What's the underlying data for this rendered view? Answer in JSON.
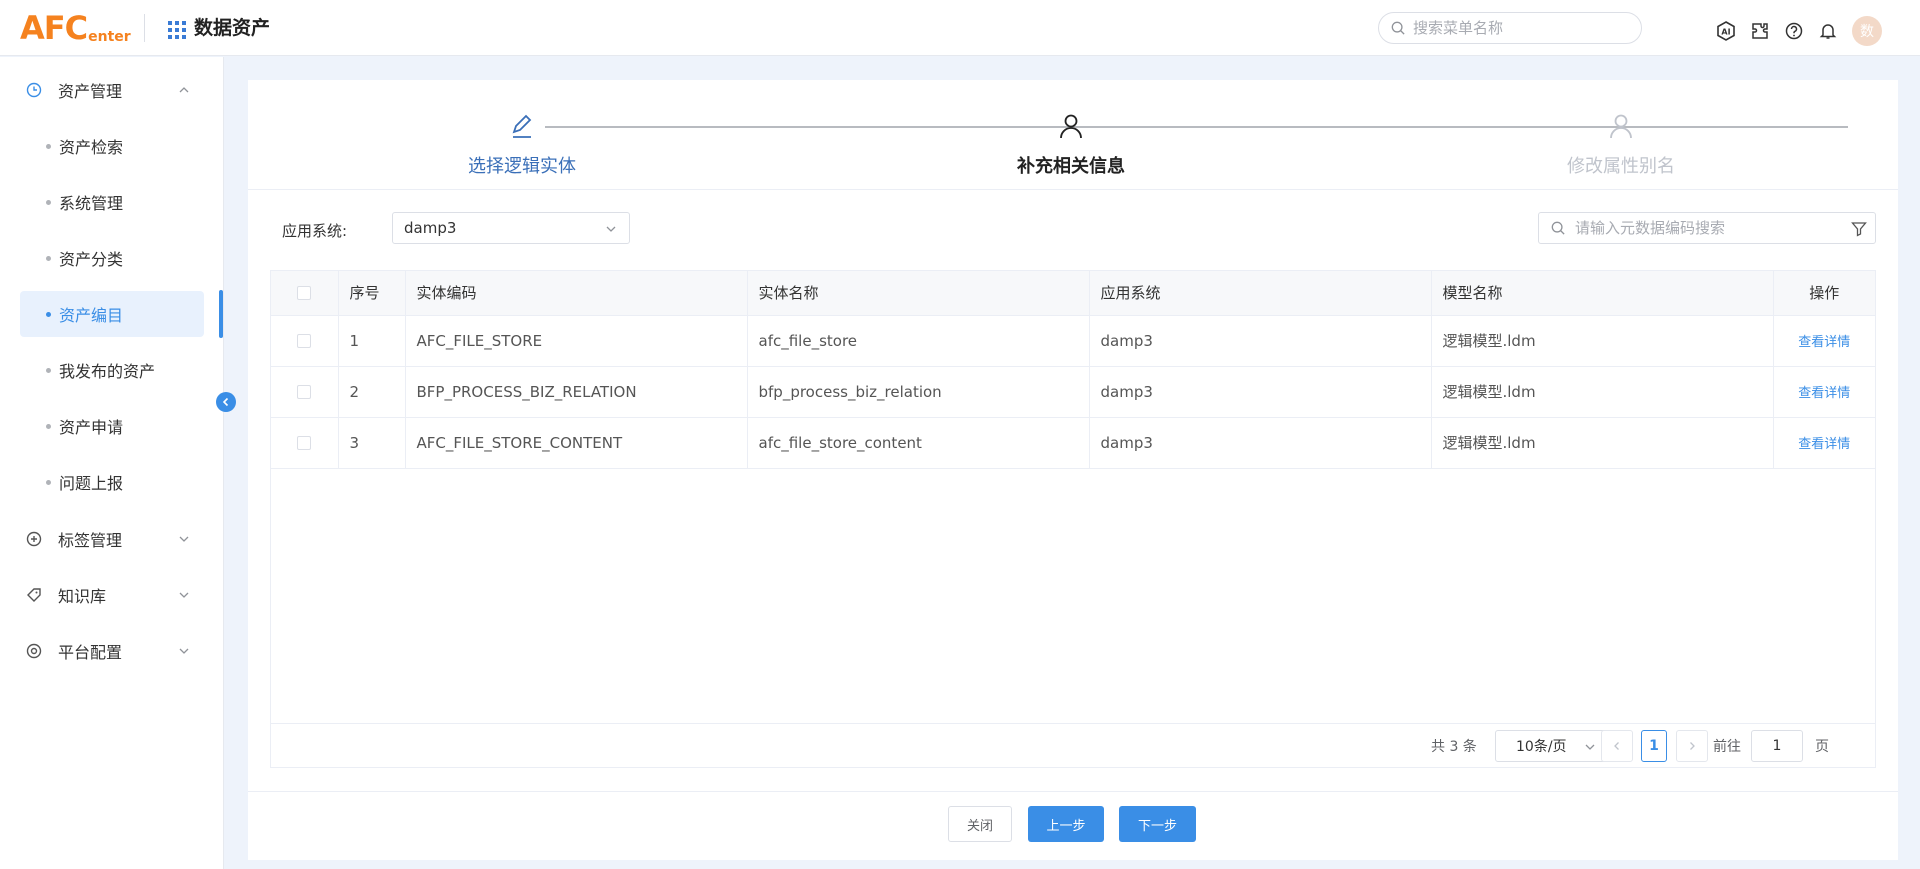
{
  "header": {
    "logo_big": "AFC",
    "logo_small": "enter",
    "app_title": "数据资产",
    "search_placeholder": "搜索菜单名称",
    "avatar_text": "数"
  },
  "sidebar": {
    "groups": [
      {
        "label": "资产管理",
        "icon": "clock-icon",
        "expanded": true
      },
      {
        "label": "标签管理",
        "icon": "plus-circle-icon",
        "expanded": false
      },
      {
        "label": "知识库",
        "icon": "tag-icon",
        "expanded": false
      },
      {
        "label": "平台配置",
        "icon": "settings-icon",
        "expanded": false
      }
    ],
    "items": [
      {
        "label": "资产检索"
      },
      {
        "label": "系统管理"
      },
      {
        "label": "资产分类"
      },
      {
        "label": "资产编目",
        "active": true
      },
      {
        "label": "我发布的资产"
      },
      {
        "label": "资产申请"
      },
      {
        "label": "问题上报"
      }
    ]
  },
  "steps": [
    {
      "label": "选择逻辑实体",
      "state": "done"
    },
    {
      "label": "补充相关信息",
      "state": "current"
    },
    {
      "label": "修改属性别名",
      "state": "pending"
    }
  ],
  "filter": {
    "label": "应用系统:",
    "value": "damp3",
    "search_placeholder": "请输入元数据编码搜索"
  },
  "table": {
    "columns": [
      "序号",
      "实体编码",
      "实体名称",
      "应用系统",
      "模型名称",
      "操作"
    ],
    "rows": [
      {
        "index": "1",
        "code": "AFC_FILE_STORE",
        "name": "afc_file_store",
        "system": "damp3",
        "model": "逻辑模型.ldm",
        "action": "查看详情"
      },
      {
        "index": "2",
        "code": "BFP_PROCESS_BIZ_RELATION",
        "name": "bfp_process_biz_relation",
        "system": "damp3",
        "model": "逻辑模型.ldm",
        "action": "查看详情"
      },
      {
        "index": "3",
        "code": "AFC_FILE_STORE_CONTENT",
        "name": "afc_file_store_content",
        "system": "damp3",
        "model": "逻辑模型.ldm",
        "action": "查看详情"
      }
    ]
  },
  "pagination": {
    "total": "共 3 条",
    "page_size": "10条/页",
    "current": "1",
    "goto_label": "前往",
    "goto_value": "1",
    "page_suffix": "页"
  },
  "footer": {
    "close": "关闭",
    "prev": "上一步",
    "next": "下一步"
  },
  "colors": {
    "primary": "#3a8ee6",
    "logo": "#f5821f",
    "done_step": "#3a6fb8",
    "pending_step": "#c0c4cc"
  }
}
